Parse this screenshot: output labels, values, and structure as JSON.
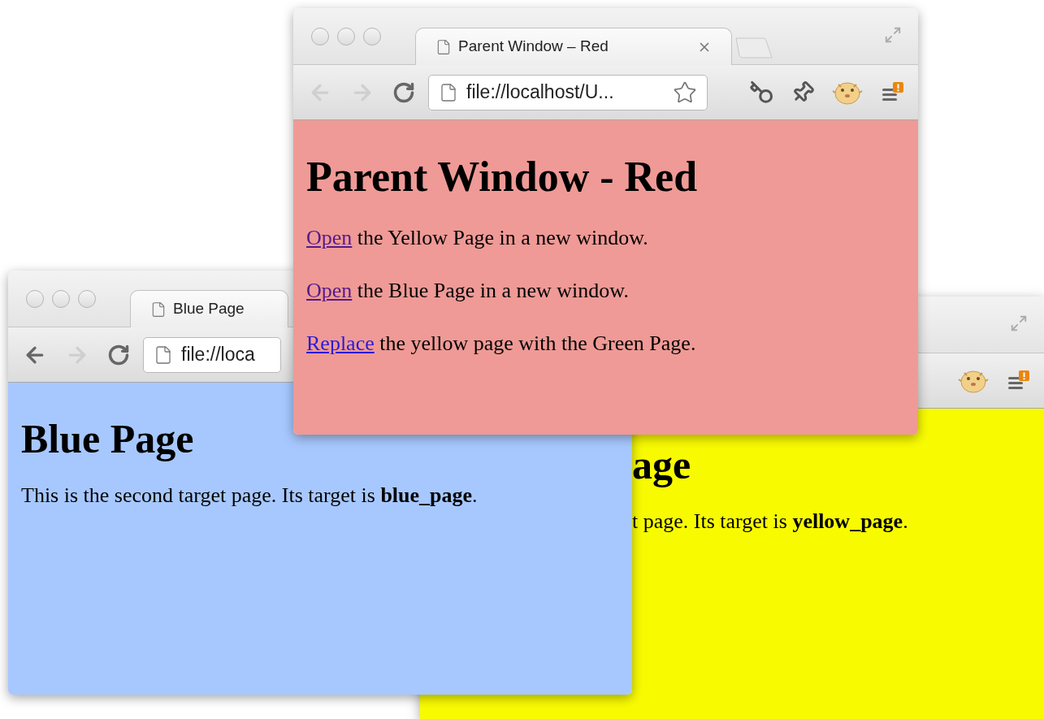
{
  "windows": [
    {
      "color": "#f8fb00",
      "heading": "age",
      "paragraphs": [
        {
          "text": "t page. Its target is **yellow_page**."
        }
      ]
    },
    {
      "color": "#a7c8fe",
      "tab_title": "Blue Page",
      "address": "file://loca",
      "back_enabled": true,
      "heading": "Blue Page",
      "paragraphs": [
        {
          "text": "This is the second target page. Its target is **blue_page**."
        }
      ]
    },
    {
      "color": "#ef9a96",
      "tab_title": "Parent Window – Red",
      "address": "file://localhost/U...",
      "back_enabled": false,
      "heading": "Parent Window - Red",
      "paragraphs": [
        {
          "link": "Open",
          "visited": true,
          "text": "the Yellow Page in a new window."
        },
        {
          "link": "Open",
          "visited": true,
          "text": "the Blue Page in a new window."
        },
        {
          "link": "Replace",
          "visited": false,
          "text": "the yellow page with the Green Page."
        }
      ]
    }
  ]
}
